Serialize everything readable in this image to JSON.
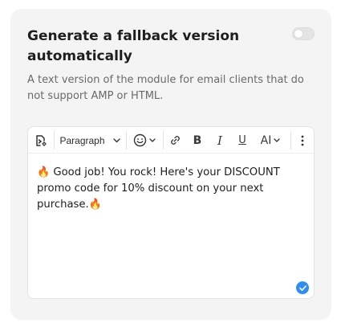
{
  "settings": {
    "title": "Generate a fallback version automatically",
    "description": "A text version of the module for email clients that do not support AMP or HTML.",
    "toggle_on": false
  },
  "toolbar": {
    "format_label": "Paragraph",
    "bold_label": "B",
    "italic_label": "I",
    "underline_label": "U",
    "font_size_label": "AI",
    "icons": [
      "variables-icon",
      "emoji-icon",
      "link-icon",
      "more-icon"
    ]
  },
  "editor": {
    "emoji": "🔥",
    "text": "Good job! You rock! Here's your DISCOUNT promo code for 10% discount on your next purchase."
  },
  "colors": {
    "card_bg": "#f4f4f4",
    "accent": "#2f8ff0"
  }
}
